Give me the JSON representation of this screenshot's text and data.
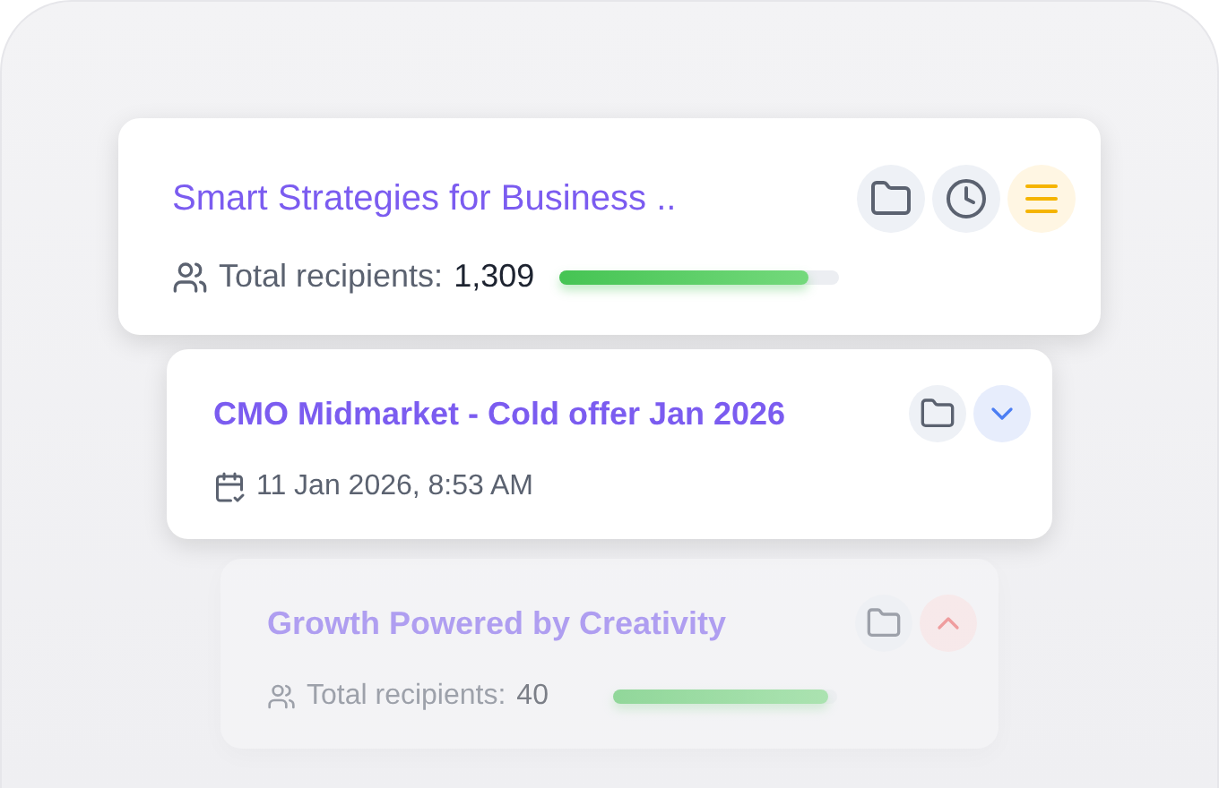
{
  "cards": [
    {
      "title": "Smart Strategies for Business ..",
      "kind": "recipients",
      "label": "Total recipients:",
      "value": "1,309",
      "level": 0.89,
      "dimmed": false,
      "actions": [
        {
          "kind": "folder"
        },
        {
          "kind": "clock"
        },
        {
          "kind": "menu"
        }
      ]
    },
    {
      "title": "CMO Midmarket - Cold offer Jan 2026",
      "kind": "date",
      "value": "11 Jan 2026, 8:53 AM",
      "dimmed": false,
      "actions": [
        {
          "kind": "folder"
        },
        {
          "kind": "chevron-down"
        }
      ]
    },
    {
      "title": "Growth Powered by Creativity",
      "kind": "recipients",
      "label": "Total recipients:",
      "value": "40",
      "level": 0.96,
      "dimmed": true,
      "actions": [
        {
          "kind": "folder"
        },
        {
          "kind": "chevron-up"
        }
      ]
    }
  ]
}
